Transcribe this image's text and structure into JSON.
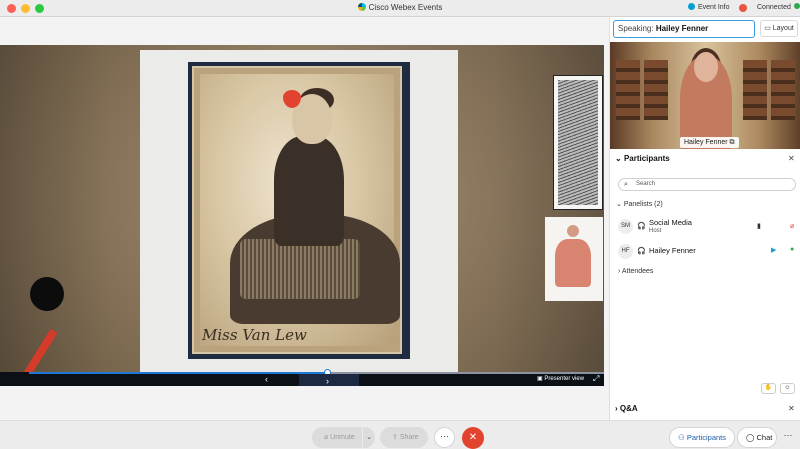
{
  "window": {
    "title": "Cisco Webex Events",
    "event_info_label": "Event Info",
    "connection_status": "Connected"
  },
  "stage": {
    "signature_text": "Miss Van Lew",
    "presenter_view_label": "Presenter view",
    "prev_icon": "chevron-left-icon",
    "next_icon": "chevron-right-icon",
    "progress": 0.52
  },
  "panel": {
    "speaking_label": "Speaking:",
    "speaking_name": "Hailey Fenner",
    "layout_label": "Layout",
    "video_name_tag": "Hailey Fenner",
    "participants_title": "Participants",
    "search_placeholder": "Search",
    "panelists_label": "Panelists (2)",
    "panelists": [
      {
        "initials": "SM",
        "name": "Social Media",
        "role": "Host"
      },
      {
        "initials": "HF",
        "name": "Hailey Fenner",
        "role": ""
      }
    ],
    "attendees_label": "Attendees",
    "qa_title": "Q&A"
  },
  "toolbar": {
    "unmute_label": "Unmute",
    "share_label": "Share",
    "more_label": "···",
    "leave_label": "✕",
    "participants_label": "Participants",
    "chat_label": "Chat"
  },
  "colors": {
    "accent_blue": "#1d78d6",
    "leave_red": "#e2432e",
    "connected_green": "#2fa84f"
  }
}
